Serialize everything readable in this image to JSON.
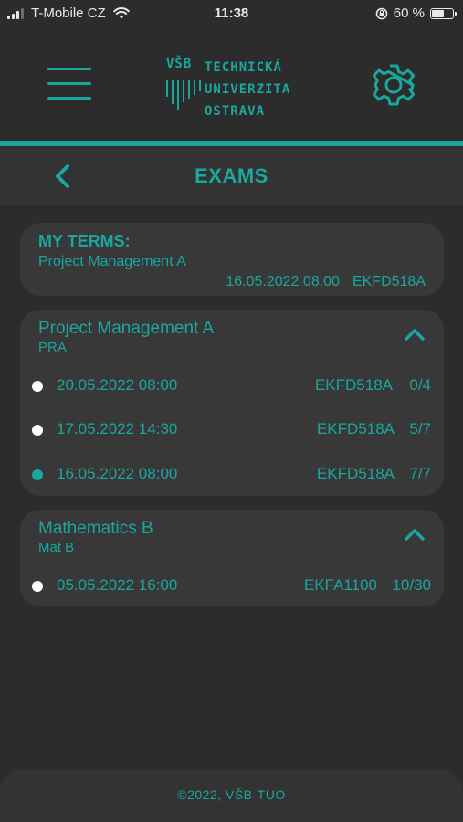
{
  "status_bar": {
    "carrier": "T-Mobile CZ",
    "time": "11:38",
    "battery_percent": "60 %",
    "battery_level": 0.6
  },
  "header": {
    "logo_vsb": "VŠB",
    "logo_line1": "TECHNICKÁ",
    "logo_line2": "UNIVERZITA",
    "logo_line3": "OSTRAVA",
    "menu_icon": "hamburger-icon",
    "settings_icon": "gear-icon",
    "accent_color": "#19a79e"
  },
  "nav": {
    "back_icon": "chevron-left-icon",
    "title": "EXAMS"
  },
  "my_terms": {
    "title": "MY TERMS:",
    "subject": "Project Management A",
    "datetime": "16.05.2022 08:00",
    "room": "EKFD518A"
  },
  "subjects": [
    {
      "name": "Project Management A",
      "code": "PRA",
      "expanded": true,
      "terms": [
        {
          "datetime": "20.05.2022 08:00",
          "room": "EKFD518A",
          "capacity": "0/4",
          "registered": false
        },
        {
          "datetime": "17.05.2022 14:30",
          "room": "EKFD518A",
          "capacity": "5/7",
          "registered": false
        },
        {
          "datetime": "16.05.2022 08:00",
          "room": "EKFD518A",
          "capacity": "7/7",
          "registered": true
        }
      ]
    },
    {
      "name": "Mathematics B",
      "code": "Mat B",
      "expanded": true,
      "terms": [
        {
          "datetime": "05.05.2022 16:00",
          "room": "EKFA1100",
          "capacity": "10/30",
          "registered": false
        }
      ]
    }
  ],
  "footer": {
    "copyright": "©2022, VŠB-TUO"
  }
}
